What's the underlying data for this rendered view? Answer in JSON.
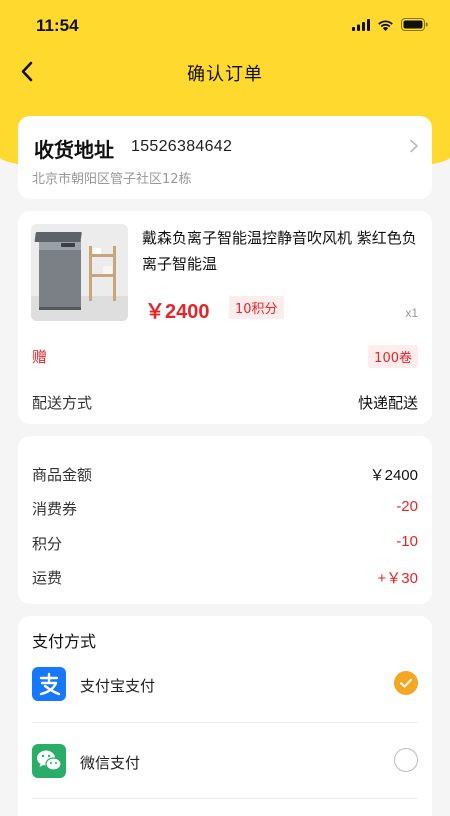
{
  "status_bar": {
    "time": "11:54"
  },
  "nav": {
    "title": "确认订单"
  },
  "address": {
    "label": "收货地址",
    "phone": "15526384642",
    "detail": "北京市朝阳区管子社区12栋"
  },
  "product": {
    "title": "戴森负离子智能温控静音吹风机 紫红色负离子智能温",
    "price": "￥2400",
    "points_badge": "10积分",
    "quantity": "x1",
    "gift_label": "赠",
    "gift_badge": "100卷",
    "shipping_label": "配送方式",
    "shipping_value": "快递配送"
  },
  "summary": {
    "rows": [
      {
        "label": "商品金额",
        "value": "￥2400"
      },
      {
        "label": "消费券",
        "value": "-20"
      },
      {
        "label": "积分",
        "value": "-10"
      },
      {
        "label": "运费",
        "value": "+￥30"
      }
    ]
  },
  "payment": {
    "title": "支付方式",
    "options": [
      {
        "label": "支付宝支付",
        "icon": "alipay-icon",
        "selected": true
      },
      {
        "label": "微信支付",
        "icon": "wechat-icon",
        "selected": false
      }
    ]
  },
  "colors": {
    "accent_yellow": "#ffd92e",
    "price_red": "#e8242a",
    "radio_selected": "#f5a623"
  }
}
